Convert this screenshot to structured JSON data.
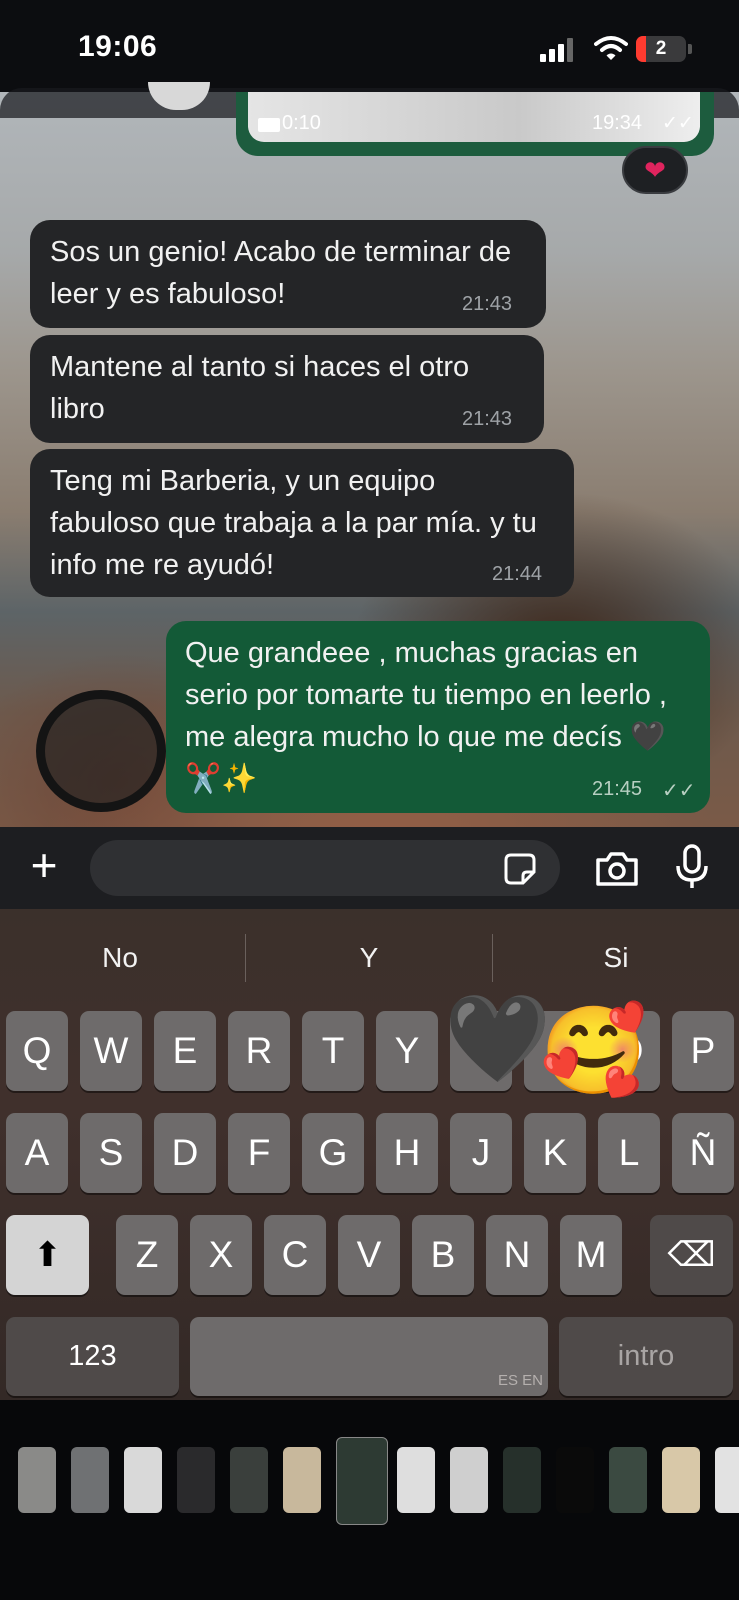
{
  "status_bar": {
    "time": "19:06",
    "battery": "2"
  },
  "video_message": {
    "duration": "0:10",
    "time": "19:34",
    "ticks": "✓✓",
    "reaction": "❤"
  },
  "messages": [
    {
      "dir": "in",
      "text": "Sos un genio! Acabo de terminar de leer y es fabuloso!",
      "time": "21:43"
    },
    {
      "dir": "in",
      "text": "Mantene al tanto si haces el otro libro",
      "time": "21:43"
    },
    {
      "dir": "in",
      "text": "Teng mi Barberia, y un equipo fabuloso que trabaja a la par mía. y tu info me re ayudó!",
      "time": "21:44"
    },
    {
      "dir": "out",
      "text": "Que grandeee , muchas gracias en serio por tomarte tu tiempo en leerlo , me alegra mucho lo que me decís 🖤✂️✨",
      "time": "21:45",
      "ticks": "✓✓"
    }
  ],
  "composer": {
    "plus": "+"
  },
  "suggestions": [
    "No",
    "Y",
    "Si"
  ],
  "keyboard": {
    "row1": [
      "Q",
      "W",
      "E",
      "R",
      "T",
      "Y",
      "U",
      "I",
      "O",
      "P"
    ],
    "row2": [
      "A",
      "S",
      "D",
      "F",
      "G",
      "H",
      "J",
      "K",
      "L",
      "Ñ"
    ],
    "row3": [
      "Z",
      "X",
      "C",
      "V",
      "B",
      "N",
      "M"
    ],
    "numbers": "123",
    "space_lang": "ES EN",
    "return": "intro",
    "shift_glyph": "⬆",
    "delete_glyph": "⌫"
  },
  "floating_emojis": [
    "🖤",
    "🥰"
  ],
  "colors": {
    "incoming": "#242527",
    "outgoing": "#135a37",
    "header": "#0c0d10"
  }
}
